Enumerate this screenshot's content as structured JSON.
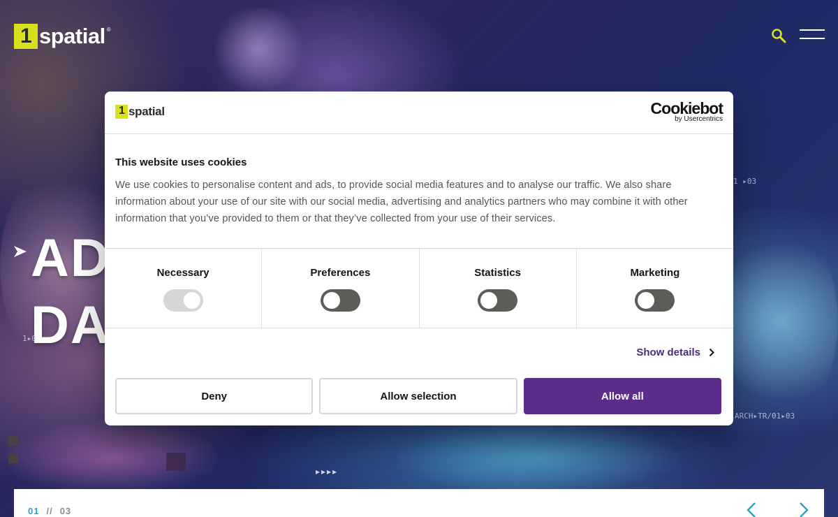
{
  "header": {
    "logo_text": "spatial",
    "logo_reg": "®",
    "search_icon": "search-icon",
    "menu_icon": "hamburger-menu-icon",
    "accent": "#d7e21d"
  },
  "hero": {
    "heading_line1": "AD",
    "heading_line2": "DA",
    "hud_top": "1 ▸03",
    "hud_left": "1▸0",
    "hud_bottom": "ARCH▸TR/01▸03",
    "slide_dots": "▸▸▸▸"
  },
  "slider": {
    "current": "01",
    "separator": "//",
    "total": "03",
    "accent": "#2aa0c8"
  },
  "cookie_dialog": {
    "logo_text": "spatial",
    "brand": "Cookiebot",
    "brand_sub": "by Usercentrics",
    "title": "This website uses cookies",
    "text": "We use cookies to personalise content and ads, to provide social media features and to analyse our traffic. We also share information about your use of our site with our social media, advertising and analytics partners who may combine it with other information that you’ve provided to them or that they’ve collected from your use of their services.",
    "categories": [
      {
        "label": "Necessary",
        "checked": true,
        "disabled": true
      },
      {
        "label": "Preferences",
        "checked": false
      },
      {
        "label": "Statistics",
        "checked": false
      },
      {
        "label": "Marketing",
        "checked": false
      }
    ],
    "show_details": "Show details",
    "buttons": {
      "deny": "Deny",
      "allow_selection": "Allow selection",
      "allow_all": "Allow all"
    },
    "primary_color": "#5b2c8a"
  }
}
